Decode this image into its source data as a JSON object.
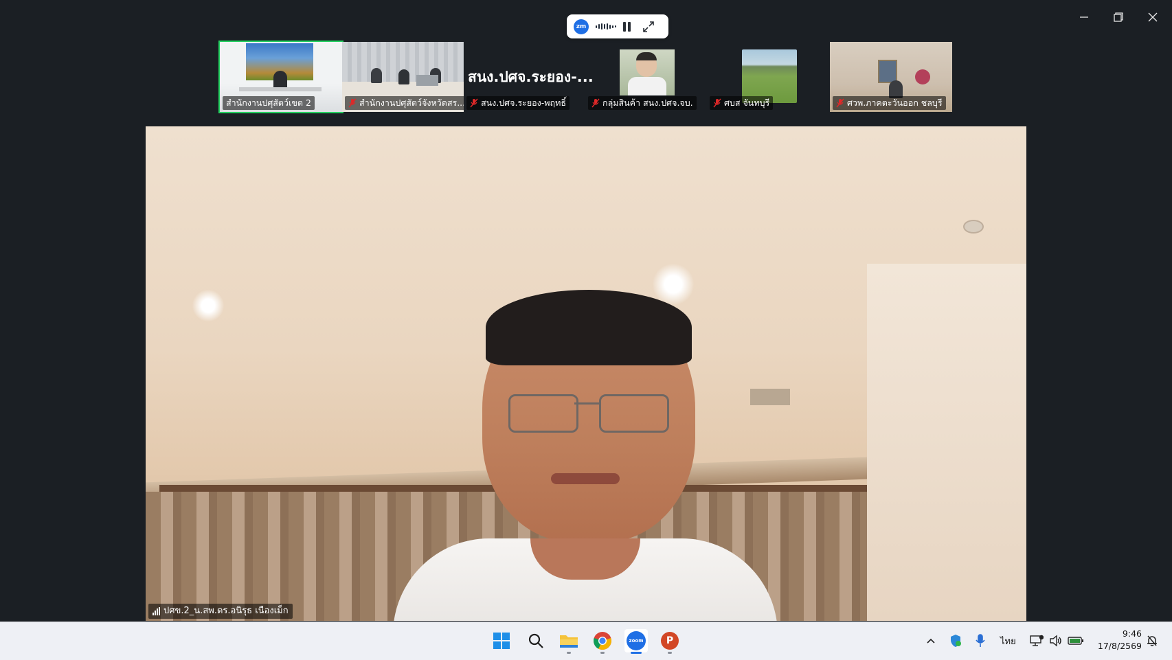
{
  "window": {
    "minimize_label": "Minimize",
    "restore_label": "Restore",
    "close_label": "Close"
  },
  "recording": {
    "logo_text": "zm",
    "state": "recording"
  },
  "thumbnails": [
    {
      "label": "สำนักงานปศุสัตว์เขต 2",
      "muted": false,
      "active": true
    },
    {
      "label": "สำนักงานปศุสัตว์จังหวัดสร...",
      "muted": true,
      "active": false
    },
    {
      "label": "สนง.ปศจ.ระยอง-พฤทธิ์",
      "muted": true,
      "active": false,
      "display_name": "สนง.ปศจ.ระยอง-..."
    },
    {
      "label": "กลุ่มสินค้า สนง.ปศจ.จบ.",
      "muted": true,
      "active": false
    },
    {
      "label": "ศบส จันทบุรี",
      "muted": true,
      "active": false
    },
    {
      "label": "ศวพ.ภาคตะวันออก ชลบุรี",
      "muted": true,
      "active": false
    }
  ],
  "main_speaker": {
    "label": "ปศข.2_น.สพ.ดร.อนิรุธ  เนืองเม็ก"
  },
  "taskbar": {
    "apps": [
      {
        "name": "start",
        "icon": "windows-icon"
      },
      {
        "name": "search",
        "icon": "search-icon"
      },
      {
        "name": "file-explorer",
        "icon": "folder-icon"
      },
      {
        "name": "chrome",
        "icon": "chrome-icon"
      },
      {
        "name": "zoom",
        "icon": "zoom-icon",
        "zoom_text": "zoom"
      },
      {
        "name": "powerpoint",
        "icon": "powerpoint-icon",
        "ppt_text": "P"
      }
    ],
    "language": "ไทย",
    "time": "9:46",
    "date": "17/8/2569"
  },
  "colors": {
    "active_speaker": "#23d160",
    "zoom_blue": "#1f6fe5",
    "mute_red": "#e02828"
  }
}
